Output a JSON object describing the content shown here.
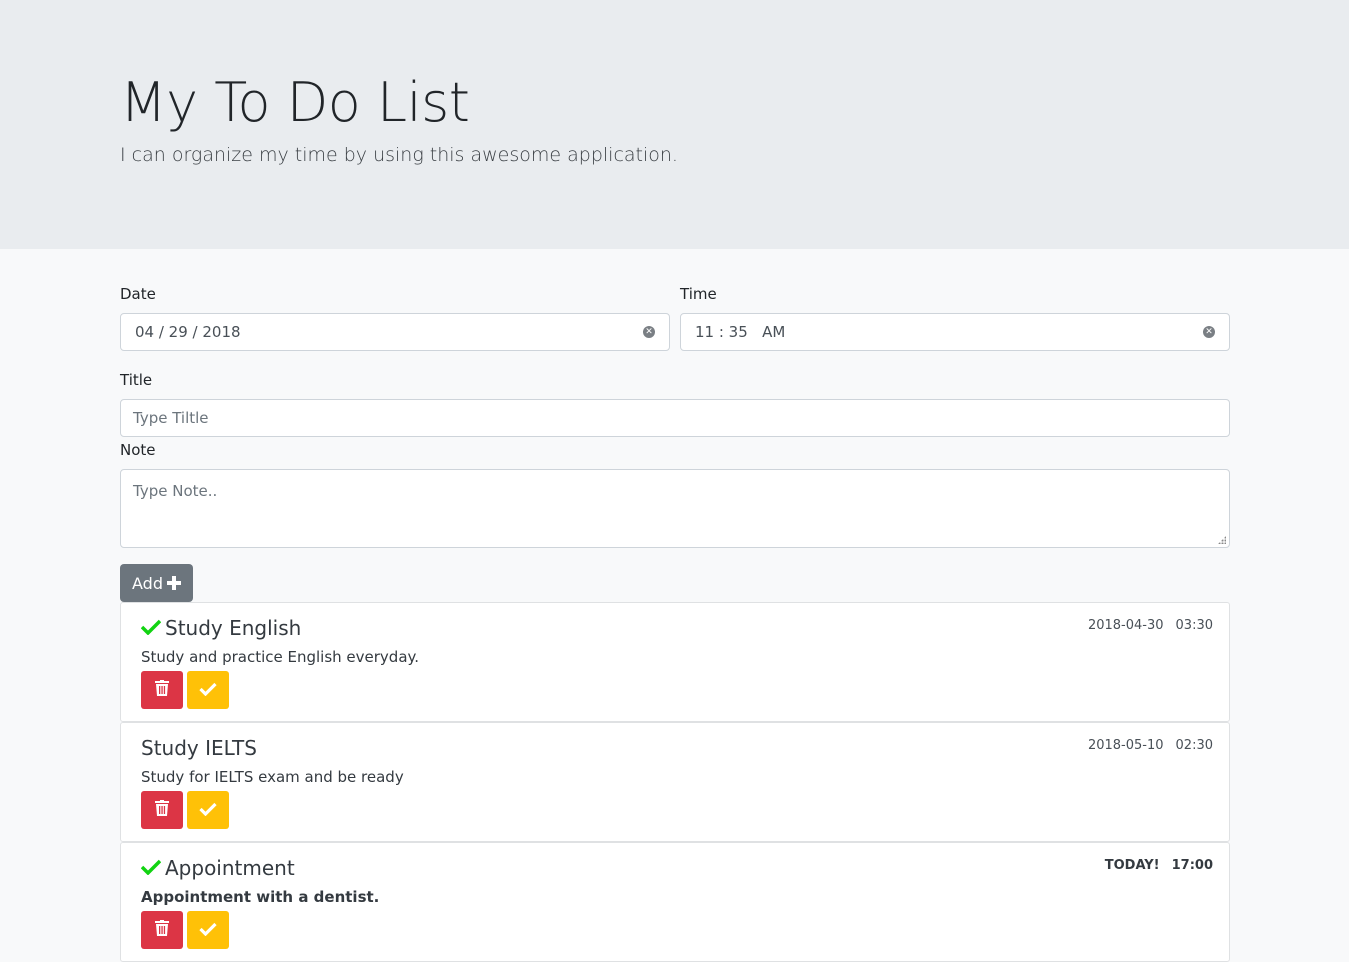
{
  "header": {
    "title": "My To Do List",
    "subtitle": "I can organize my time by using this awesome application."
  },
  "form": {
    "date_label": "Date",
    "date_value": "04 / 29 / 2018",
    "time_label": "Time",
    "time_value": "11 : 35   AM",
    "title_label": "Title",
    "title_placeholder": "Type Tiltle",
    "note_label": "Note",
    "note_placeholder": "Type Note..",
    "add_label": "Add"
  },
  "todos": [
    {
      "title": "Study English",
      "note": "Study and practice English everyday.",
      "date": "2018-04-30",
      "time": "03:30",
      "done": true,
      "today": false
    },
    {
      "title": "Study IELTS",
      "note": "Study for IELTS exam and be ready",
      "date": "2018-05-10",
      "time": "02:30",
      "done": false,
      "today": false
    },
    {
      "title": "Appointment",
      "note": "Appointment with a dentist.",
      "date": "TODAY!",
      "time": "17:00",
      "done": true,
      "today": true
    }
  ],
  "colors": {
    "delete": "#dc3545",
    "done": "#ffc107",
    "check": "#12d312",
    "add": "#6c757d"
  },
  "icons": {
    "delete": "trash-icon",
    "done": "check-icon",
    "add": "plus-icon",
    "clear": "clear-icon"
  }
}
